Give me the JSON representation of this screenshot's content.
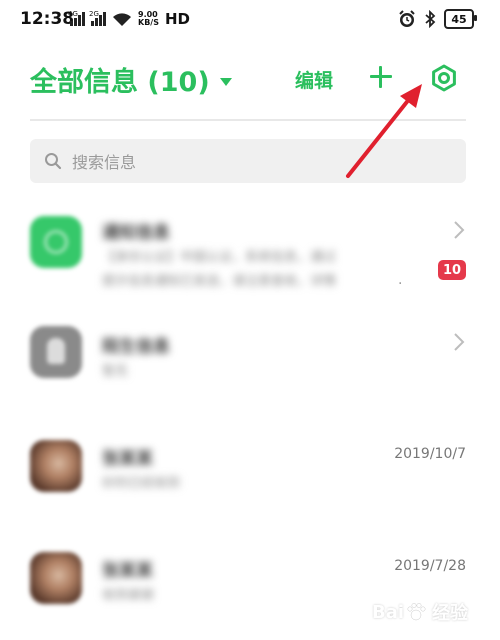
{
  "status_bar": {
    "time": "12:38",
    "net1_label": "4G",
    "net2_label": "2G",
    "speed_value": "9.00",
    "speed_unit": "KB/S",
    "hd_label": "HD",
    "battery_level": "45"
  },
  "header": {
    "title": "全部信息 (10)",
    "edit_label": "编辑",
    "accent_color": "#2bbf5e"
  },
  "search": {
    "placeholder": "搜索信息"
  },
  "conversations": [
    {
      "icon": "notification-icon",
      "name": "通知信息",
      "preview_lines": [
        "【身份认证】中国认证，系统信息，通过",
        "提示信息通知已发送，请注意查收，详情"
      ],
      "unread": "10"
    },
    {
      "icon": "contact-icon",
      "name": "陌生信息",
      "preview_lines": [
        "暂无"
      ]
    },
    {
      "icon": "user-photo",
      "name": "张某某",
      "preview_lines": [
        "好的已经收到"
      ],
      "date": "2019/10/7"
    },
    {
      "icon": "user-photo",
      "name": "张某某",
      "preview_lines": [
        "收到谢谢"
      ],
      "date": "2019/7/28"
    }
  ],
  "watermark": {
    "brand": "Bai",
    "brand_suffix": "经验"
  },
  "colors": {
    "badge": "#e5394b",
    "annotation_arrow": "#e0202e"
  }
}
